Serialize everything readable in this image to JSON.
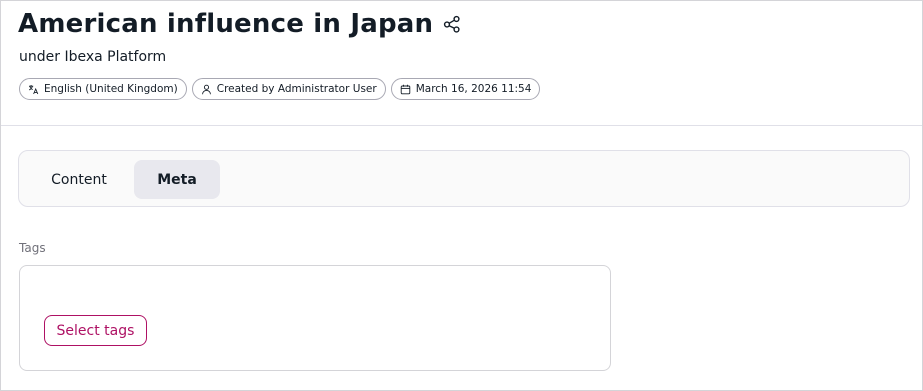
{
  "page": {
    "title": "American influence in Japan",
    "location": "under Ibexa Platform"
  },
  "meta_pills": [
    {
      "icon": "translation-icon",
      "label": "English (United Kingdom)"
    },
    {
      "icon": "user-icon",
      "label": "Created by Administrator User"
    },
    {
      "icon": "calendar-icon",
      "label": "March 16, 2026 11:54"
    }
  ],
  "tabs": [
    {
      "label": "Content",
      "active": false
    },
    {
      "label": "Meta",
      "active": true
    }
  ],
  "fields": {
    "tags": {
      "label": "Tags",
      "button_label": "Select tags"
    }
  },
  "colors": {
    "accent": "#ae1164",
    "active_tab_bg": "#e8e8ee",
    "text": "#131c26",
    "muted_text": "#71717a"
  }
}
